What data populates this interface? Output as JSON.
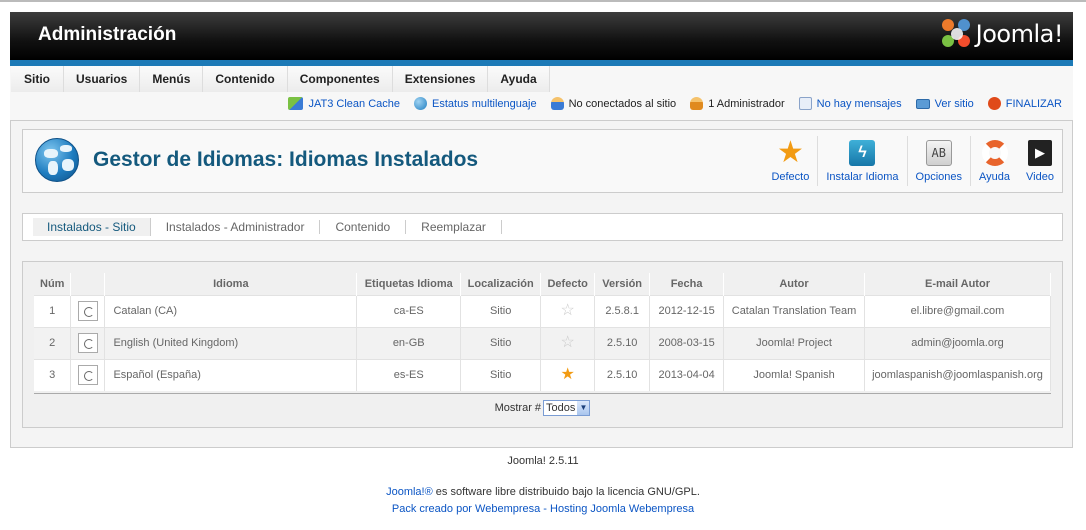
{
  "header": {
    "title": "Administración",
    "logo_text": "Joomla!"
  },
  "menu": [
    "Sitio",
    "Usuarios",
    "Menús",
    "Contenido",
    "Componentes",
    "Extensiones",
    "Ayuda"
  ],
  "status": {
    "cache": "JAT3 Clean Cache",
    "multilang": "Estatus multilenguaje",
    "offline": "No conectados al sitio",
    "admins": "1 Administrador",
    "messages": "No hay mensajes",
    "view_site": "Ver sitio",
    "logout": "FINALIZAR"
  },
  "page": {
    "title": "Gestor de Idiomas: Idiomas Instalados"
  },
  "toolbar": {
    "default": "Defecto",
    "install": "Instalar Idioma",
    "options": "Opciones",
    "help": "Ayuda",
    "video": "Video"
  },
  "subtabs": [
    "Instalados - Sitio",
    "Instalados - Administrador",
    "Contenido",
    "Reemplazar"
  ],
  "table": {
    "headers": [
      "Núm",
      "",
      "Idioma",
      "Etiquetas Idioma",
      "Localización",
      "Defecto",
      "Versión",
      "Fecha",
      "Autor",
      "E-mail Autor"
    ],
    "rows": [
      {
        "num": "1",
        "language": "Catalan (CA)",
        "tag": "ca-ES",
        "location": "Sitio",
        "default": false,
        "version": "2.5.8.1",
        "date": "2012-12-15",
        "author": "Catalan Translation Team",
        "email": "el.libre@gmail.com"
      },
      {
        "num": "2",
        "language": "English (United Kingdom)",
        "tag": "en-GB",
        "location": "Sitio",
        "default": false,
        "version": "2.5.10",
        "date": "2008-03-15",
        "author": "Joomla! Project",
        "email": "admin@joomla.org"
      },
      {
        "num": "3",
        "language": "Español (España)",
        "tag": "es-ES",
        "location": "Sitio",
        "default": true,
        "version": "2.5.10",
        "date": "2013-04-04",
        "author": "Joomla! Spanish",
        "email": "joomlaspanish@joomlaspanish.org"
      }
    ],
    "display_label": "Mostrar #",
    "display_value": "Todos"
  },
  "footer": {
    "version": "Joomla! 2.5.11",
    "license_link": "Joomla!®",
    "license_text": " es software libre distribuido bajo la licencia GNU/GPL.",
    "credit": "Pack creado por Webempresa - Hosting Joomla Webempresa"
  },
  "colors": {
    "accent": "#1d7ab7",
    "title": "#14597d",
    "link": "#0b55c4",
    "star": "#f29b13"
  }
}
